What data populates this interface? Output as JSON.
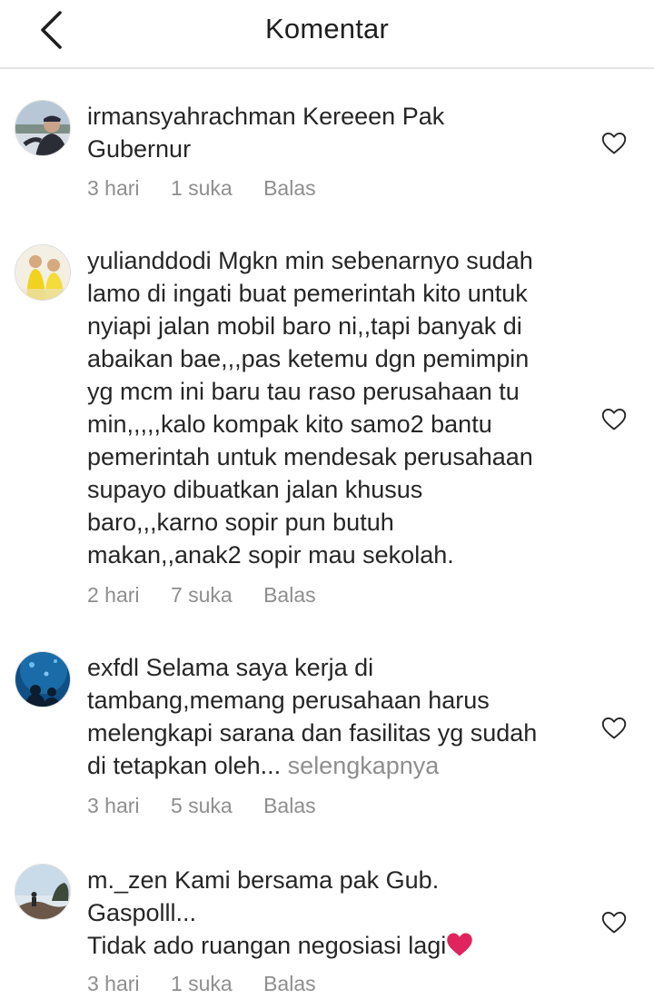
{
  "header": {
    "title": "Komentar",
    "back_icon": "chevron-left-icon"
  },
  "comments": [
    {
      "username": "irmansyahrachman",
      "lines": [
        "Kereeen Pak",
        "Gubernur"
      ],
      "time": "3 hari",
      "likes": "1 suka",
      "reply": "Balas"
    },
    {
      "username": "yulianddodi",
      "lines": [
        "Mgkn min sebenarnyo sudah",
        "lamo di ingati buat pemerintah kito untuk",
        "nyiapi jalan mobil baro ni,,tapi banyak di",
        "abaikan bae,,,pas ketemu dgn pemimpin",
        "yg mcm ini baru tau raso perusahaan tu",
        "min,,,,,kalo kompak kito samo2 bantu",
        "pemerintah untuk mendesak perusahaan",
        "supayo dibuatkan jalan khusus",
        "baro,,,karno sopir pun butuh",
        "makan,,anak2 sopir mau sekolah."
      ],
      "time": "2 hari",
      "likes": "7 suka",
      "reply": "Balas"
    },
    {
      "username": "exfdl",
      "lines": [
        "Selama saya kerja di",
        "tambang,memang perusahaan harus",
        "melengkapi sarana dan fasilitas yg sudah",
        "di tetapkan oleh..."
      ],
      "more": "selengkapnya",
      "time": "3 hari",
      "likes": "5 suka",
      "reply": "Balas"
    },
    {
      "username": "m._zen",
      "lines": [
        "Kami bersama pak Gub.",
        "Gaspolll...",
        "Tidak ado ruangan negosiasi lagi"
      ],
      "emoji": "red-heart-icon",
      "time": "3 hari",
      "likes": "1 suka",
      "reply": "Balas"
    }
  ],
  "colors": {
    "text": "#262626",
    "meta": "#8e8e8e",
    "divider": "#e3e3e3",
    "heart_emoji": "#e0245e"
  }
}
